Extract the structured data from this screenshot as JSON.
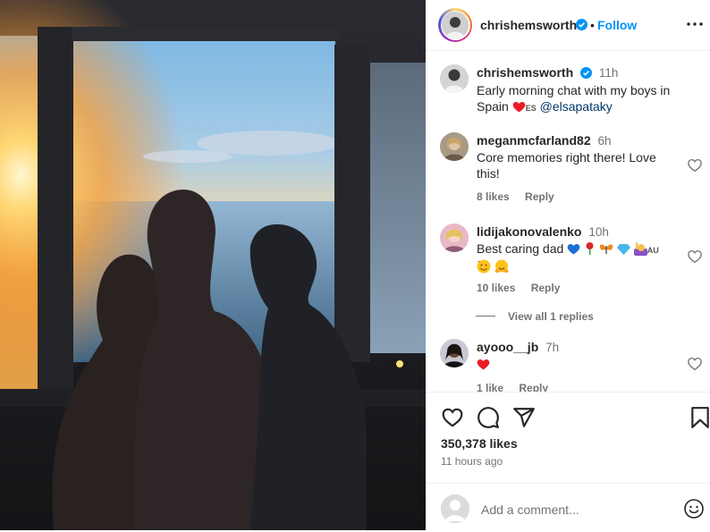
{
  "post": {
    "author": "chrishemsworth",
    "follow_label": "Follow",
    "separator": "•",
    "caption": {
      "username": "chrishemsworth",
      "time": "11h",
      "text": "Early morning chat with my boys in Spain",
      "flag_code": "ES",
      "mention": "@elsapataky"
    },
    "likes": "350,378 likes",
    "time_ago": "11 hours ago"
  },
  "comments": [
    {
      "username": "meganmcfarland82",
      "time": "6h",
      "text": "Core memories right there! Love this!",
      "likes": "8 likes",
      "reply_label": "Reply"
    },
    {
      "username": "lidijakonovalenko",
      "time": "10h",
      "text": "Best caring dad",
      "flag_code": "AU",
      "likes": "10 likes",
      "reply_label": "Reply"
    },
    {
      "username": "ayooo__jb",
      "time": "7h",
      "text": "",
      "likes": "1 like",
      "reply_label": "Reply"
    }
  ],
  "view_replies_label": "View all 1 replies",
  "add_comment": {
    "placeholder": "Add a comment..."
  },
  "icons": {
    "verified": "verified-badge-icon",
    "more": "more-options-icon",
    "like": "heart-icon",
    "comment": "comment-icon",
    "share": "share-icon",
    "save": "bookmark-icon",
    "emoji": "emoji-icon"
  },
  "colors": {
    "accent": "#0095f6",
    "heart_red": "#ed1c24",
    "muted": "#737373",
    "text": "#262626"
  }
}
